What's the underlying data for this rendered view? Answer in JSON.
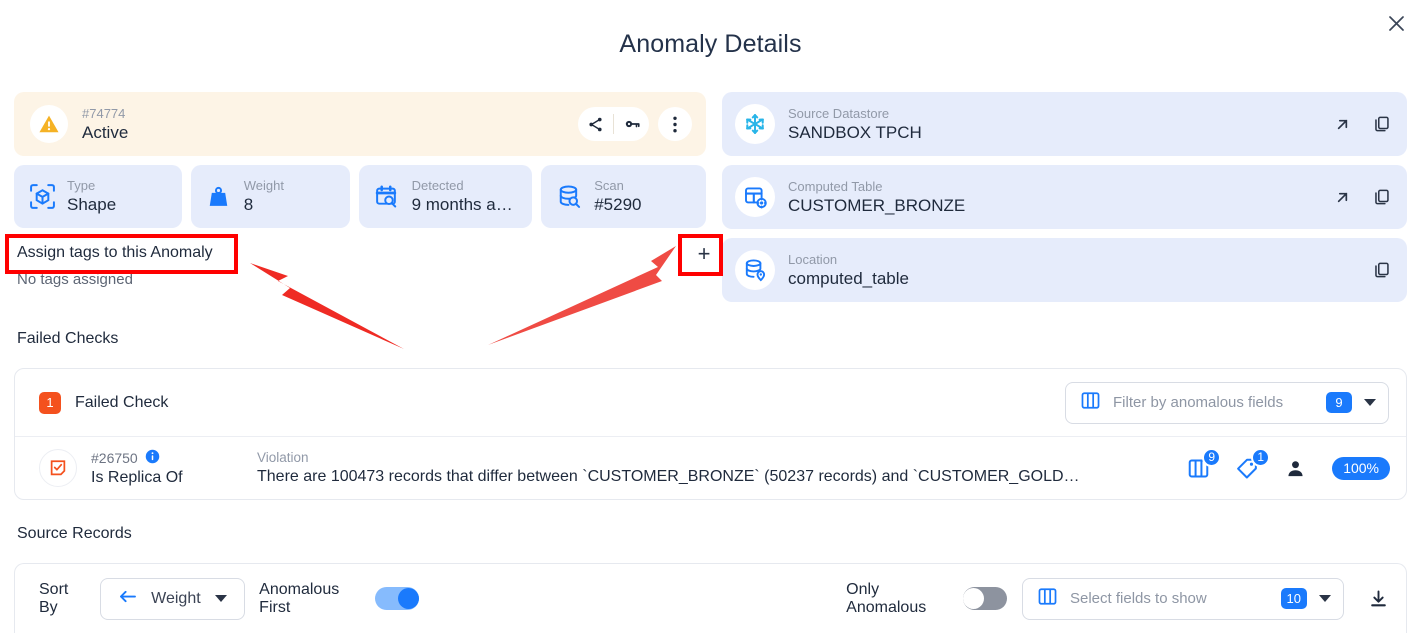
{
  "header": {
    "title": "Anomaly Details",
    "close_icon": "close-icon"
  },
  "status_banner": {
    "icon": "warning-triangle-icon",
    "id": "#74774",
    "status": "Active",
    "actions": [
      {
        "name": "share-icon",
        "label": "Share"
      },
      {
        "name": "key-icon",
        "label": "Key"
      },
      {
        "name": "more-vertical-icon",
        "label": "More"
      }
    ]
  },
  "meta_cards": [
    {
      "icon": "cube-scan-icon",
      "label": "Type",
      "value": "Shape"
    },
    {
      "icon": "weight-icon",
      "label": "Weight",
      "value": "8"
    },
    {
      "icon": "calendar-search-icon",
      "label": "Detected",
      "value": "9 months a…"
    },
    {
      "icon": "database-search-icon",
      "label": "Scan",
      "value": "#5290"
    }
  ],
  "tags": {
    "title": "Assign tags to this Anomaly",
    "empty_text": "No tags assigned",
    "add_button_label": "+"
  },
  "info_cards": [
    {
      "icon": "snowflake-icon",
      "label": "Source Datastore",
      "value": "SANDBOX TPCH",
      "actions": [
        "external-link-icon",
        "copy-icon"
      ]
    },
    {
      "icon": "computed-table-icon",
      "label": "Computed Table",
      "value": "CUSTOMER_BRONZE",
      "actions": [
        "external-link-icon",
        "copy-icon"
      ]
    },
    {
      "icon": "database-location-icon",
      "label": "Location",
      "value": "computed_table",
      "actions": [
        "copy-icon"
      ]
    }
  ],
  "failed_checks": {
    "heading": "Failed Checks",
    "count": "1",
    "count_label": "Failed Check",
    "filter": {
      "icon": "columns-icon",
      "placeholder": "Filter by anomalous fields",
      "badge": "9",
      "caret": "chevron-down-icon"
    },
    "row": {
      "icon": "rule-check-icon",
      "id": "#26750",
      "info_icon": "info-icon",
      "name": "Is Replica Of",
      "violation_label": "Violation",
      "violation_text": "There are 100473 records that differ between `CUSTOMER_BRONZE` (50237 records) and `CUSTOMER_GOLD…",
      "badges": [
        {
          "icon": "columns-icon",
          "count": "9"
        },
        {
          "icon": "tag-icon",
          "count": "1"
        },
        {
          "icon": "person-icon",
          "count": ""
        }
      ],
      "percent": "100%"
    }
  },
  "source_records": {
    "heading": "Source Records",
    "sort_by_label": "Sort By",
    "sort_arrow_icon": "arrow-left-icon",
    "sort_value": "Weight",
    "sort_caret": "chevron-down-icon",
    "anomalous_first_label": "Anomalous First",
    "anomalous_first_on": true,
    "only_anomalous_label": "Only Anomalous",
    "only_anomalous_on": false,
    "fields_select": {
      "icon": "columns-icon",
      "placeholder": "Select fields to show",
      "badge": "10",
      "caret": "chevron-down-icon"
    },
    "download_icon": "download-icon"
  },
  "colors": {
    "accent_blue": "#1a7afc",
    "banner_bg": "#fdf4e6",
    "card_bg": "#e6ecfb",
    "warning_amber": "#f5b225",
    "danger_orange": "#f4511e",
    "annotation_red": "#ff0000",
    "title_navy": "#24324a"
  }
}
